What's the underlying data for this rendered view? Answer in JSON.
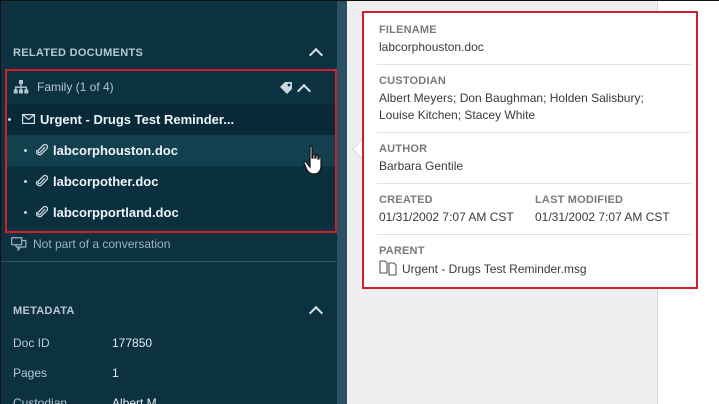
{
  "related_documents": {
    "title": "RELATED DOCUMENTS",
    "family": {
      "label": "Family (1 of 4)",
      "items": [
        {
          "name": "Urgent - Drugs Test Reminder...",
          "icon": "envelope-icon"
        },
        {
          "name": "labcorphouston.doc",
          "icon": "paperclip-icon"
        },
        {
          "name": "labcorpother.doc",
          "icon": "paperclip-icon"
        },
        {
          "name": "labcorpportland.doc",
          "icon": "paperclip-icon"
        }
      ]
    },
    "conversation": "Not part of a conversation"
  },
  "metadata": {
    "title": "METADATA",
    "rows": [
      {
        "key": "Doc ID",
        "value": "177850"
      },
      {
        "key": "Pages",
        "value": "1"
      },
      {
        "key": "Custodian",
        "value": "Albert M..."
      }
    ]
  },
  "popup": {
    "filename_label": "FILENAME",
    "filename": "labcorphouston.doc",
    "custodian_label": "CUSTODIAN",
    "custodian_line1": "Albert Meyers; Don Baughman; Holden Salisbury;",
    "custodian_line2": "Louise Kitchen; Stacey White",
    "author_label": "AUTHOR",
    "author": "Barbara Gentile",
    "created_label": "CREATED",
    "created": "01/31/2002 7:07 AM CST",
    "modified_label": "LAST MODIFIED",
    "modified": "01/31/2002 7:07 AM CST",
    "parent_label": "PARENT",
    "parent": "Urgent - Drugs Test Reminder.msg"
  },
  "colors": {
    "panel_bg": "#0c3242",
    "highlight_border": "#d0202a"
  }
}
